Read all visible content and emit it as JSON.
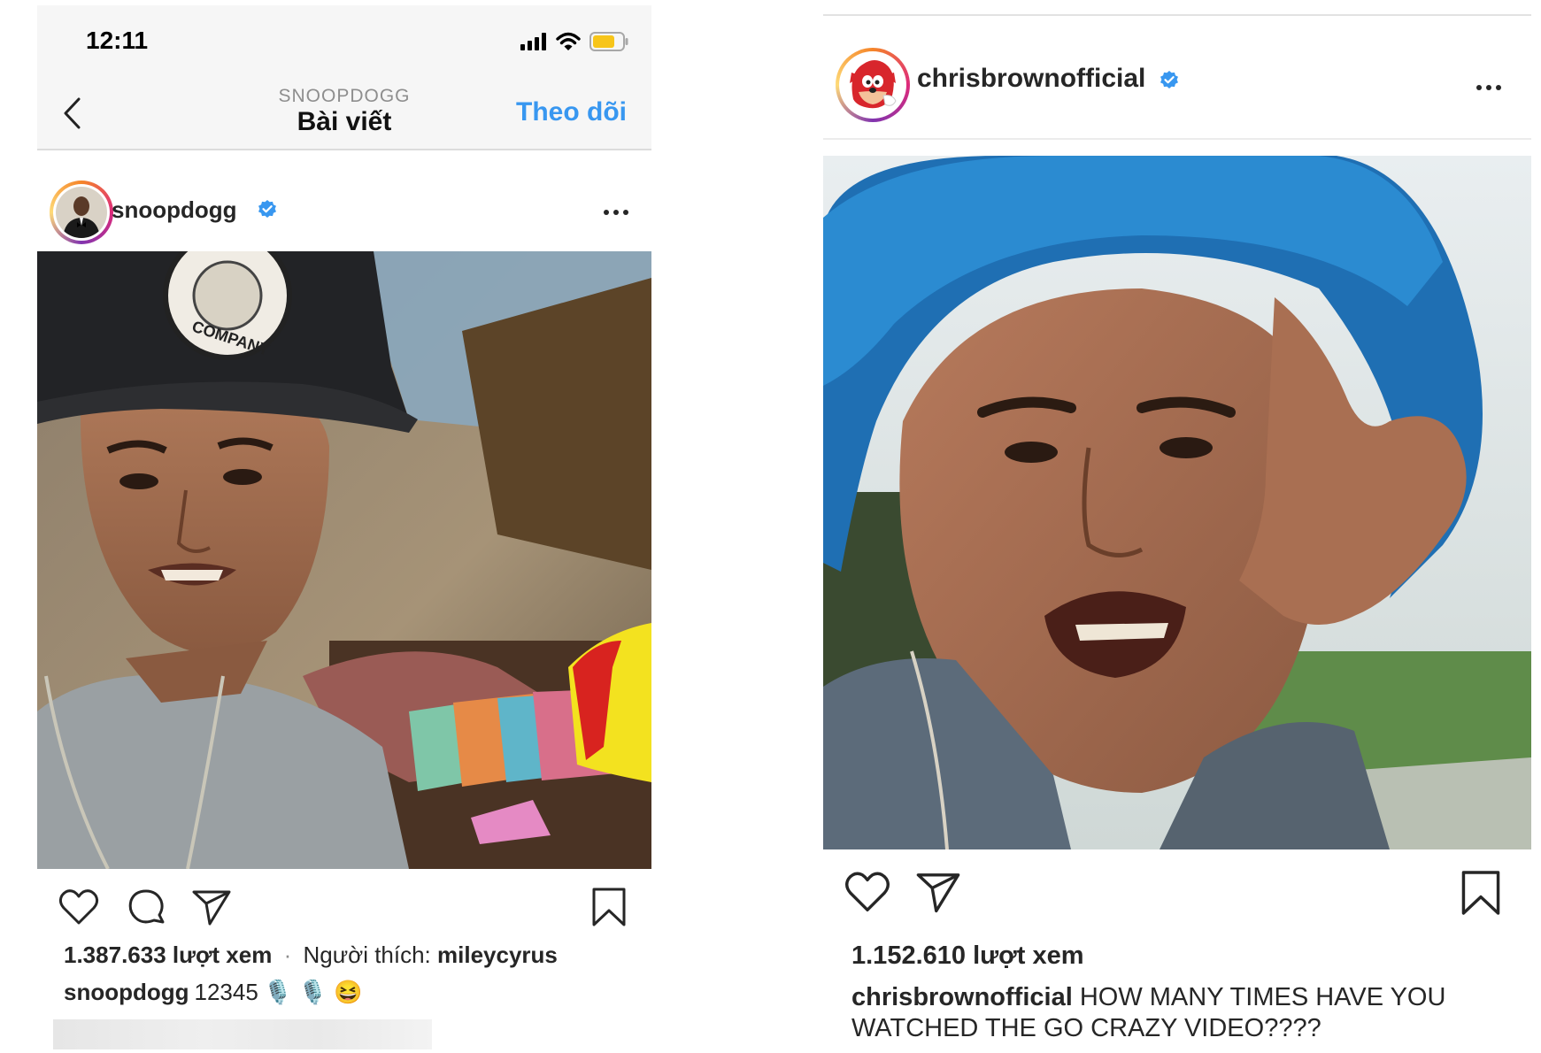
{
  "left_post": {
    "status_bar": {
      "time": "12:11",
      "icons": [
        "signal-icon",
        "wifi-icon",
        "battery-icon"
      ]
    },
    "nav": {
      "back_icon": "chevron-left-icon",
      "subtitle": "SNOOPDOGG",
      "title": "Bài viết",
      "follow_label": "Theo dõi"
    },
    "header": {
      "username": "snoopdogg",
      "verified": true
    },
    "actions": [
      "heart-icon",
      "comment-icon",
      "send-icon",
      "bookmark-icon"
    ],
    "views": "1.387.633 lượt xem",
    "separator": "·",
    "liked_by_prefix": "Người thích:",
    "liked_by_user": "mileycyrus",
    "caption": {
      "username": "snoopdogg",
      "text": "12345",
      "emojis": "🎙️ 🎙️ 😆"
    }
  },
  "right_post": {
    "header": {
      "username": "chrisbrownofficial",
      "verified": true
    },
    "actions": [
      "heart-icon",
      "send-icon",
      "bookmark-icon"
    ],
    "views": "1.152.610 lượt xem",
    "caption": {
      "username": "chrisbrownofficial",
      "text": "HOW MANY TIMES HAVE YOU WATCHED THE GO CRAZY VIDEO????"
    }
  },
  "colors": {
    "link_blue": "#3897f0",
    "verified_blue": "#3897f0",
    "text": "#262626",
    "bar_bg": "#f6f6f6"
  }
}
